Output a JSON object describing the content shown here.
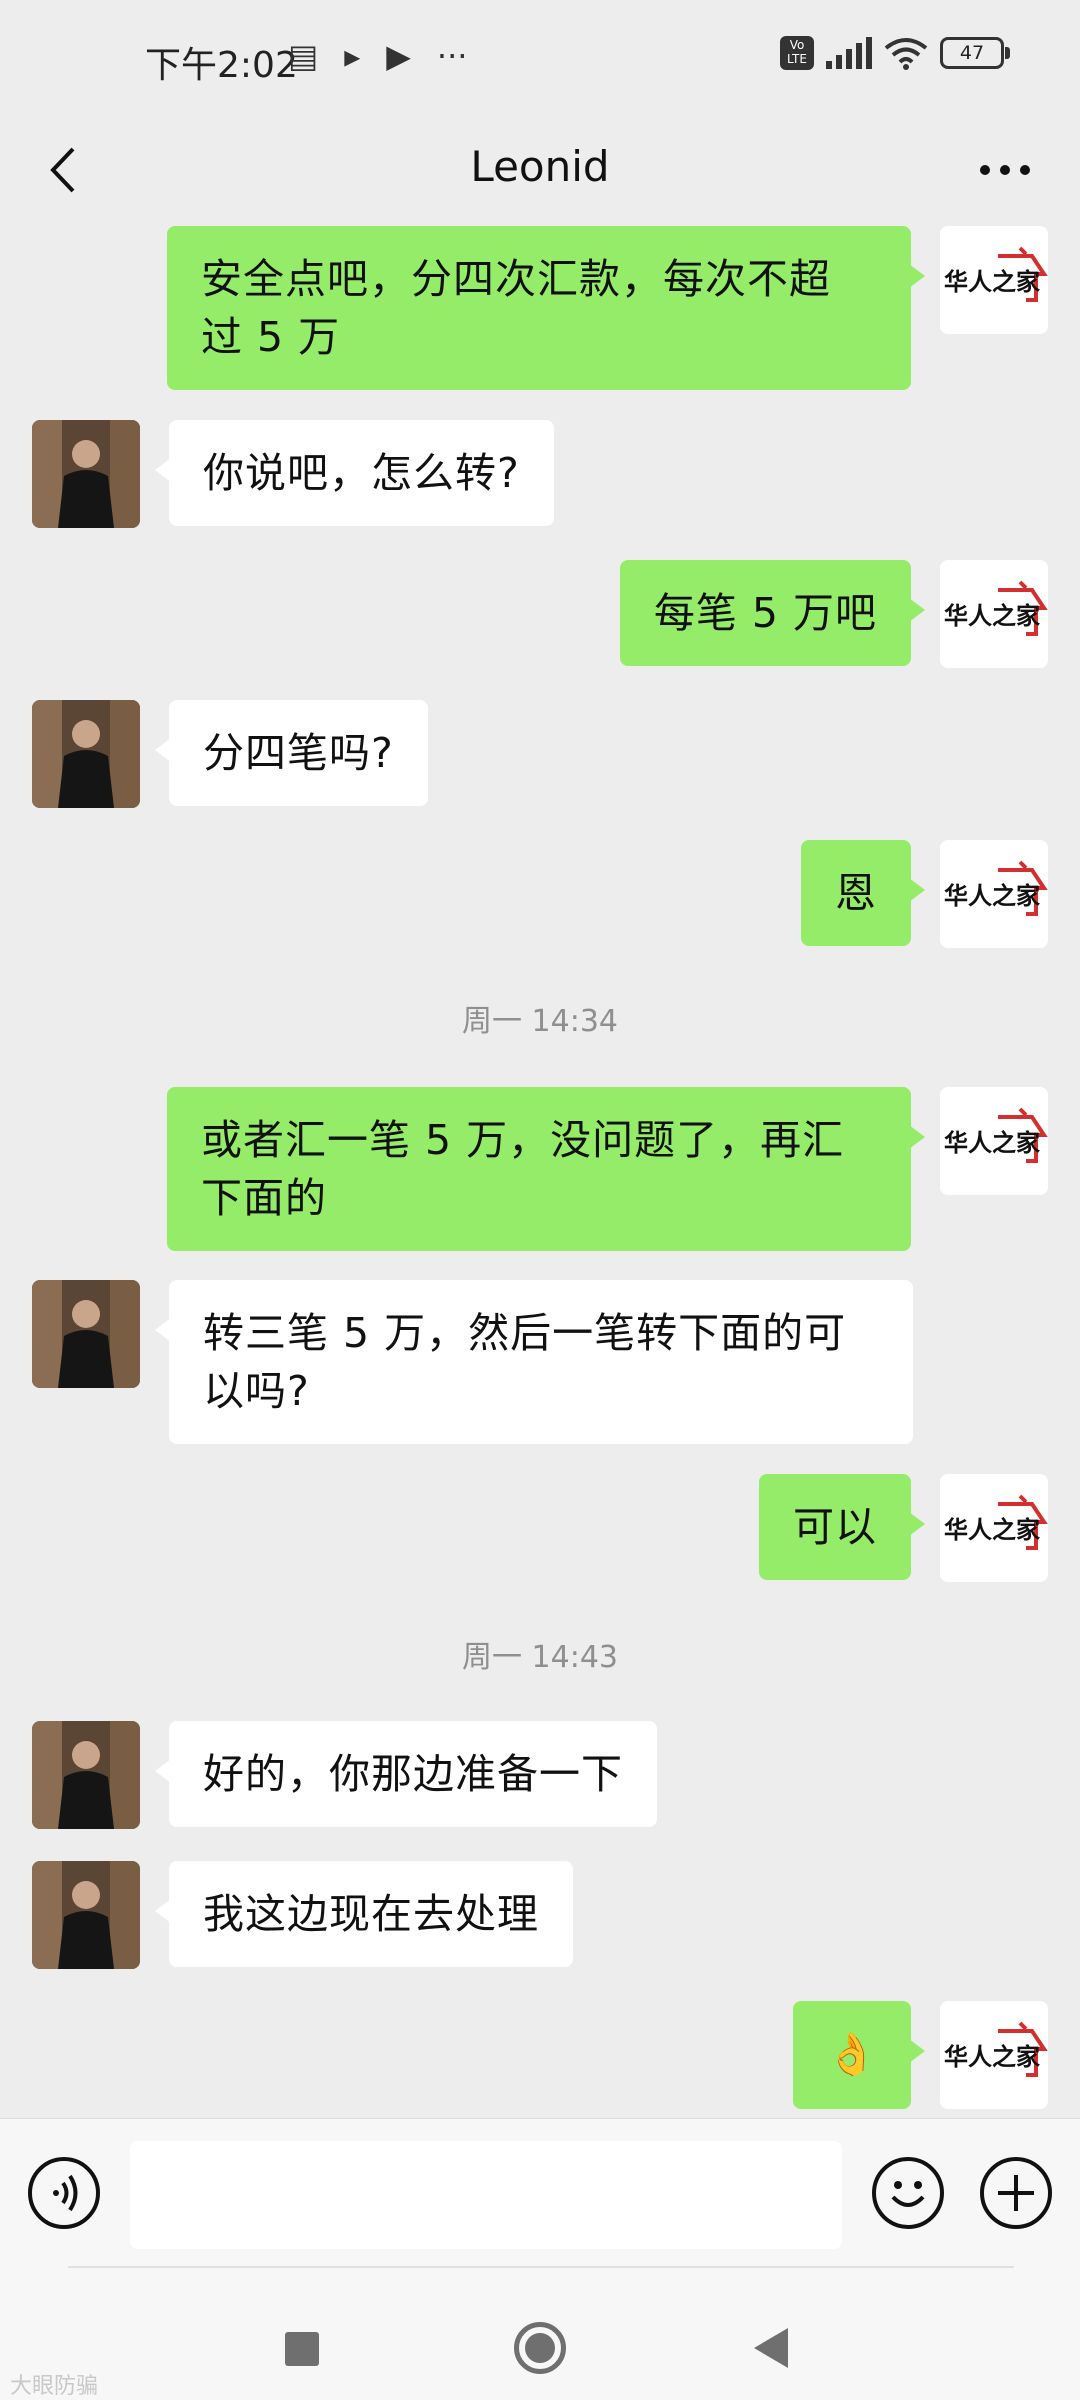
{
  "status_bar": {
    "time": "下午2:02",
    "battery": "47",
    "volte": "Vo LTE",
    "icons": [
      "message-icon",
      "play-icon",
      "play-store-icon",
      "more-notifications-icon",
      "volte-icon",
      "signal-icon",
      "wifi-icon",
      "battery-icon"
    ]
  },
  "nav": {
    "title": "Leonid",
    "back_icon": "chevron-left-icon",
    "more_icon": "more-dots-icon"
  },
  "self_avatar_text": "华人之家",
  "messages": [
    {
      "from": "self",
      "lines": [
        "安全点吧，分四次汇款，每次不超",
        "过 5 万"
      ]
    },
    {
      "from": "other",
      "lines": [
        "你说吧，怎么转?"
      ]
    },
    {
      "from": "self",
      "lines": [
        "每笔 5 万吧"
      ]
    },
    {
      "from": "other",
      "lines": [
        "分四笔吗?"
      ]
    },
    {
      "from": "self",
      "lines": [
        "恩"
      ]
    },
    {
      "timestamp": "周一 14:34"
    },
    {
      "from": "self",
      "lines": [
        "或者汇一笔 5 万，没问题了，再汇",
        "下面的"
      ]
    },
    {
      "from": "other",
      "lines": [
        "转三笔 5 万，然后一笔转下面的可",
        "以吗?"
      ]
    },
    {
      "from": "self",
      "lines": [
        "可以"
      ]
    },
    {
      "timestamp": "周一 14:43"
    },
    {
      "from": "other",
      "lines": [
        "好的，你那边准备一下"
      ]
    },
    {
      "from": "other",
      "lines": [
        "我这边现在去处理"
      ]
    },
    {
      "from": "self",
      "lines": [
        "👌"
      ]
    }
  ],
  "input_bar": {
    "voice_icon": "voice-icon",
    "emoji_icon": "emoji-icon",
    "plus_icon": "plus-icon",
    "placeholder": ""
  },
  "android_nav": [
    "recents-icon",
    "home-icon",
    "back-icon"
  ],
  "watermark": "大眼防骗"
}
